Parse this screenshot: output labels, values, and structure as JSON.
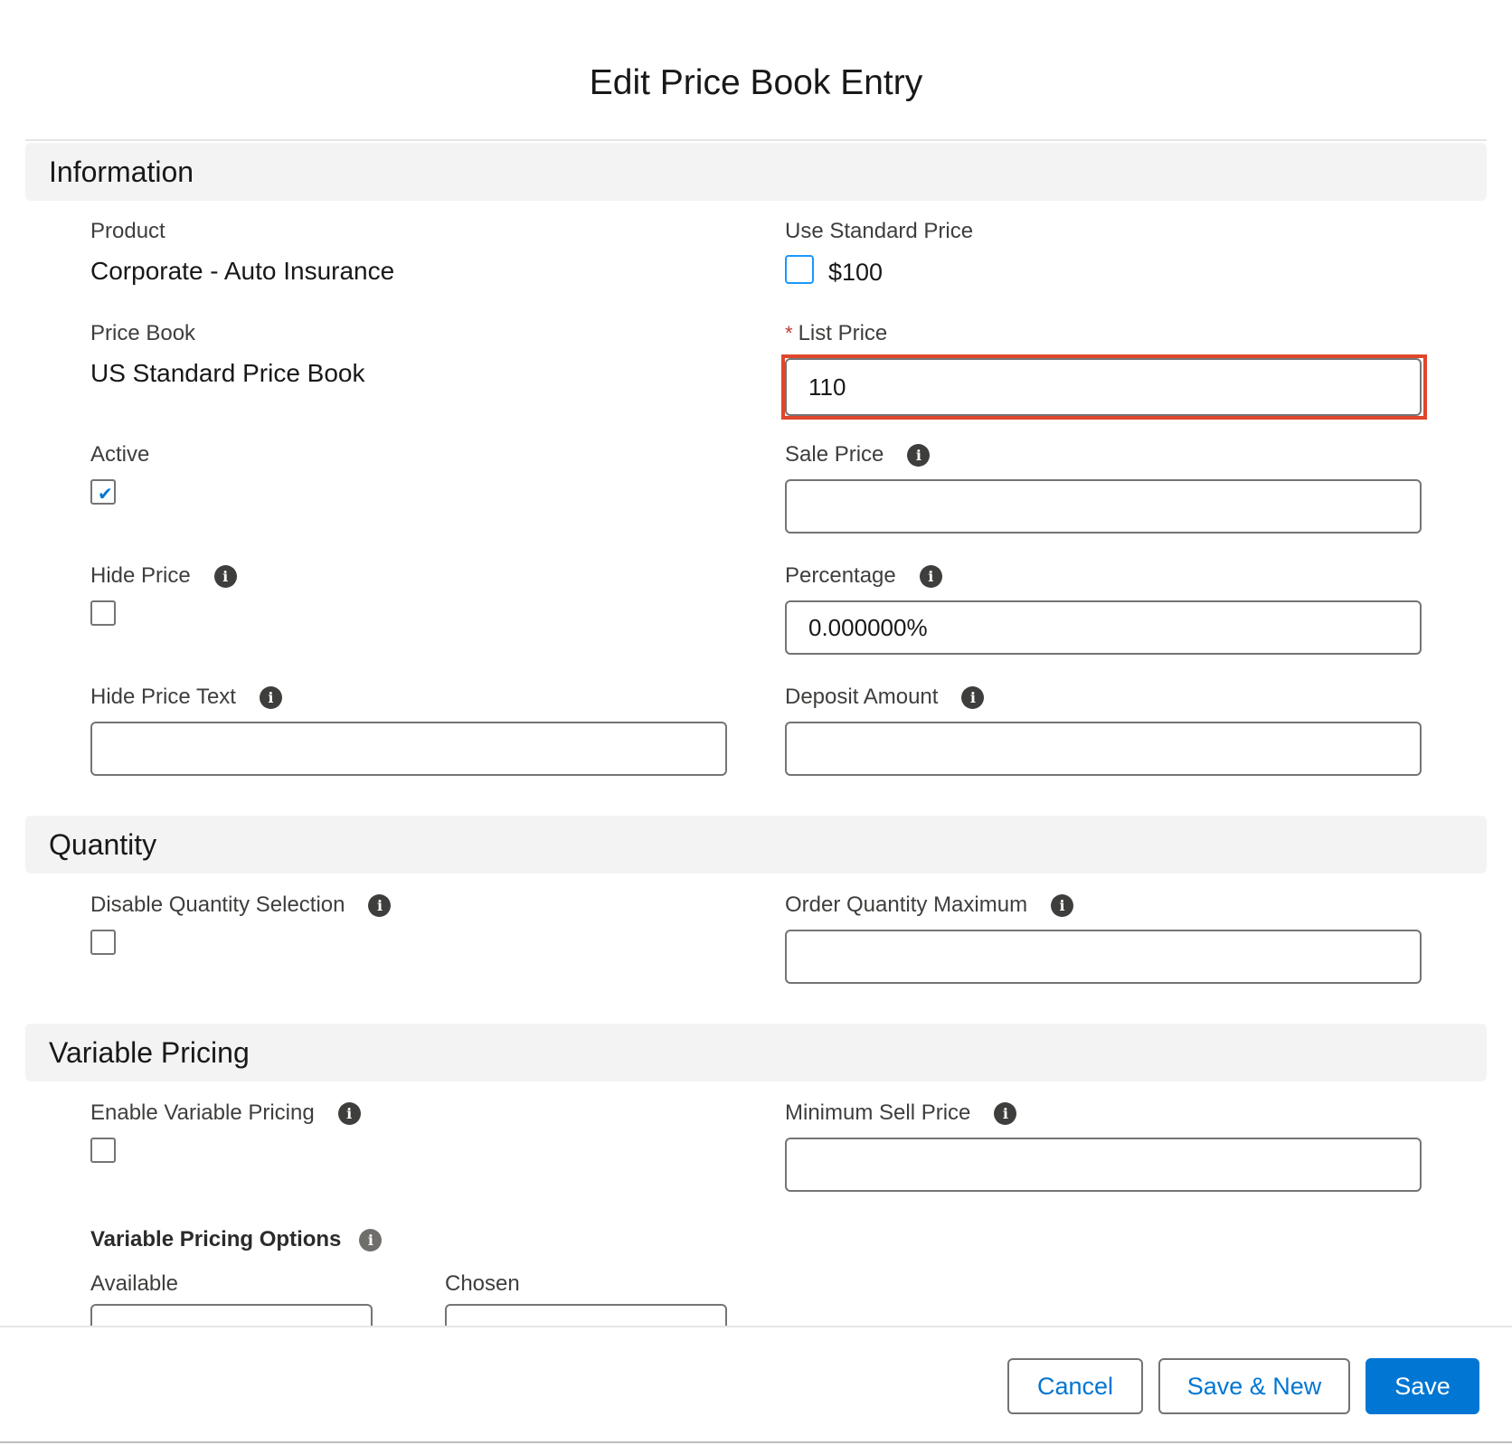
{
  "modal": {
    "title": "Edit Price Book Entry"
  },
  "sections": {
    "information": "Information",
    "quantity": "Quantity",
    "variable_pricing": "Variable Pricing"
  },
  "fields": {
    "product_label": "Product",
    "product_value": "Corporate - Auto Insurance",
    "price_book_label": "Price Book",
    "price_book_value": "US Standard Price Book",
    "active_label": "Active",
    "active_checked": true,
    "hide_price_label": "Hide Price",
    "hide_price_text_label": "Hide Price Text",
    "hide_price_text_value": "",
    "use_standard_price_label": "Use Standard Price",
    "standard_price_value": "$100",
    "list_price_required": "*",
    "list_price_label": "List Price",
    "list_price_value": "110",
    "sale_price_label": "Sale Price",
    "sale_price_value": "",
    "percentage_label": "Percentage",
    "percentage_value": "0.000000%",
    "deposit_amount_label": "Deposit Amount",
    "deposit_amount_value": "",
    "disable_quantity_label": "Disable Quantity Selection",
    "order_quantity_max_label": "Order Quantity Maximum",
    "order_quantity_max_value": "",
    "enable_variable_pricing_label": "Enable Variable Pricing",
    "minimum_sell_price_label": "Minimum Sell Price",
    "minimum_sell_price_value": "",
    "variable_pricing_options_label": "Variable Pricing Options",
    "available_label": "Available",
    "chosen_label": "Chosen"
  },
  "icons": {
    "info": "info-icon",
    "info_glyph": "i",
    "check_glyph": "✔"
  },
  "footer": {
    "cancel": "Cancel",
    "save_new": "Save & New",
    "save": "Save"
  },
  "colors": {
    "brand": "#0176d3",
    "highlight": "#e0462b",
    "required": "#c23934"
  }
}
